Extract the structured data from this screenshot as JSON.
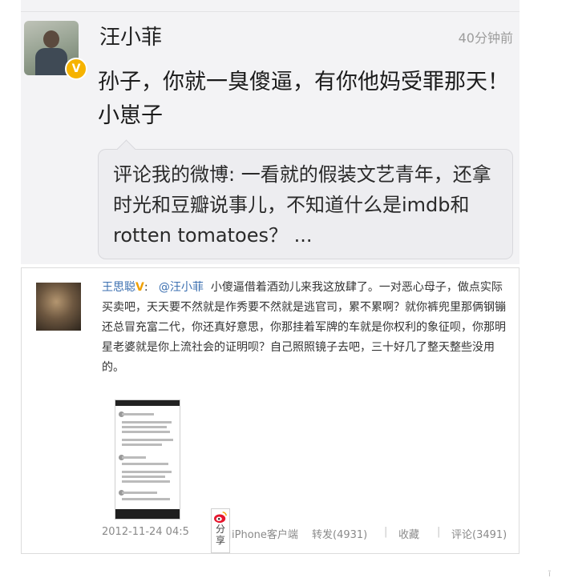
{
  "post_top": {
    "username": "汪小菲",
    "verified_badge": "V",
    "time": "40分钟前",
    "text": "孙子，你就一臭傻逼，有你他妈受罪那天！小崽子",
    "quoted": {
      "prefix": "评论我的微博: ",
      "text": "一看就的假装文艺青年，还拿时光和豆瓣说事儿，不知道什么是imdb和rotten tomatoes？ ..."
    }
  },
  "post_bottom": {
    "username": "王思聪",
    "verified_badge": "V",
    "colon": ":",
    "mention": "@汪小菲",
    "text": "小傻逼借着酒劲儿来我这放肆了。一对恶心母子，做点实际买卖吧，天天要不然就是作秀要不然就是逃官司，累不累啊？就你裤兜里那俩钢镚还总冒充富二代，你还真好意思，你那挂着军牌的车就是你权利的象征呗，你那明星老婆就是你上流社会的证明呗？自己照照镜子去吧，三十好几了整天整些没用的。",
    "timestamp": "2012-11-24 04:5",
    "source": "来自iPhone客户端",
    "repost": "转发(4931)",
    "favorite": "收藏",
    "comment": "评论(3491)",
    "separator": "|",
    "share_popup_label": "分享"
  },
  "watermark": "ĩ",
  "colors": {
    "link_blue": "#3b6fb0",
    "verified_gold": "#f6b300",
    "meta_gray": "#9c9c9c"
  }
}
